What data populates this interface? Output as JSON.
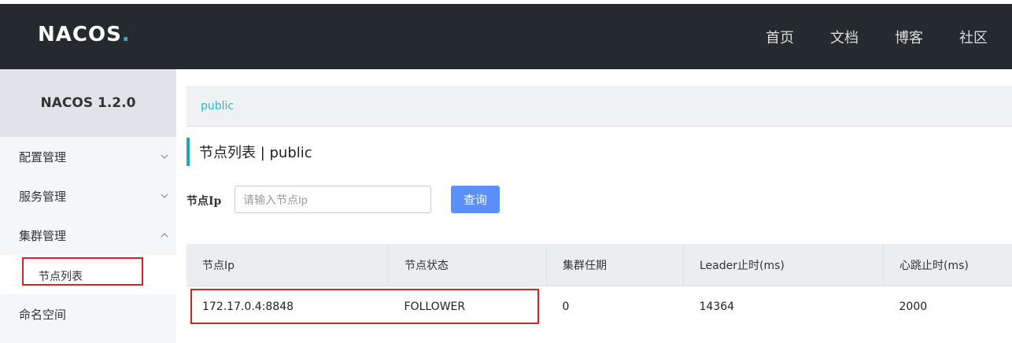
{
  "header": {
    "logo": "NACOS",
    "logo_dot": ".",
    "nav": [
      "首页",
      "文档",
      "博客",
      "社区"
    ]
  },
  "sidebar": {
    "title": "NACOS 1.2.0",
    "items": [
      {
        "label": "配置管理",
        "chevron": "chevron-down-icon"
      },
      {
        "label": "服务管理",
        "chevron": "chevron-down-icon"
      },
      {
        "label": "集群管理",
        "chevron": "chevron-up-icon"
      }
    ],
    "subitem": "节点列表",
    "last_item": "命名空间"
  },
  "breadcrumb": "public",
  "page_title": "节点列表 | public",
  "filter": {
    "label": "节点Ip",
    "placeholder": "请输入节点Ip",
    "value": "",
    "button": "查询"
  },
  "table": {
    "columns": [
      "节点Ip",
      "节点状态",
      "集群任期",
      "Leader止时(ms)",
      "心跳止时(ms)"
    ],
    "rows": [
      [
        "172.17.0.4:8848",
        "FOLLOWER",
        "0",
        "14364",
        "2000"
      ]
    ]
  },
  "colors": {
    "topbar": "#252a2f",
    "accent": "#1fb7d4",
    "button": "#5b8ff9",
    "highlight": "#e02020"
  }
}
